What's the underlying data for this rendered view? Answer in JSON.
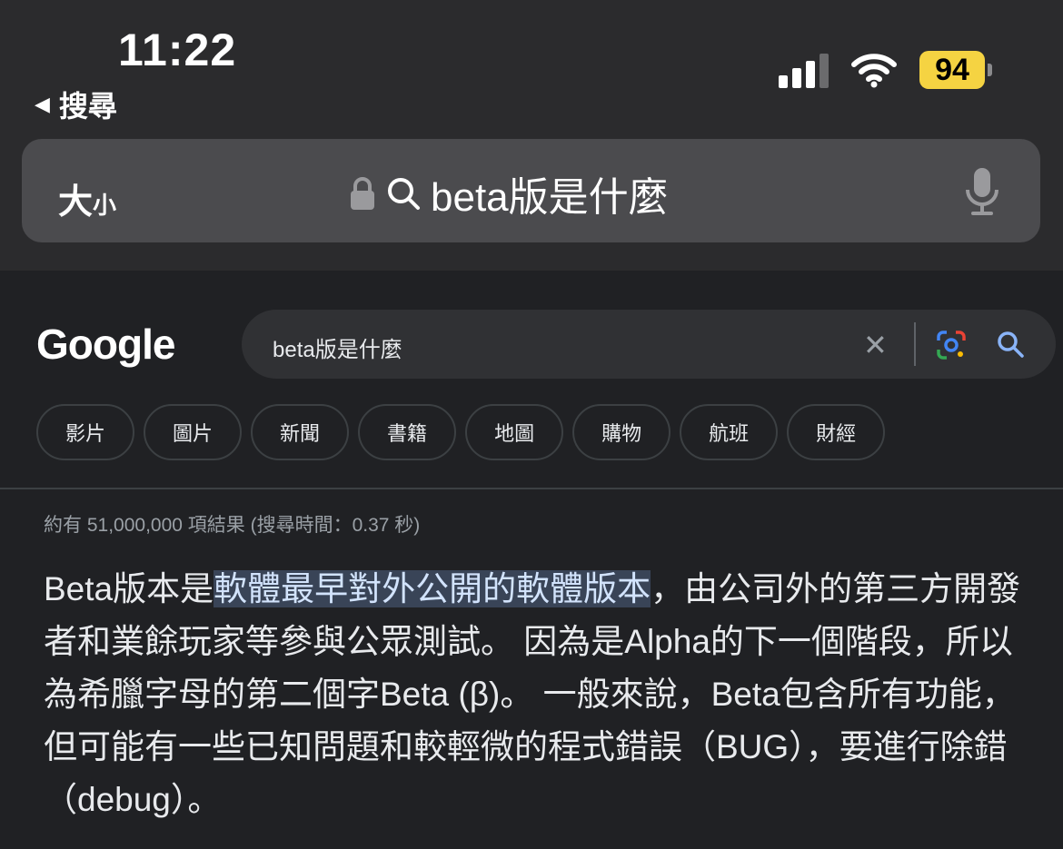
{
  "status_bar": {
    "time": "11:22",
    "back_label": "搜尋",
    "battery": "94"
  },
  "safari": {
    "text_size_big": "大",
    "text_size_small": "小",
    "url_query": "beta版是什麼"
  },
  "google": {
    "logo": "Google",
    "search_value": "beta版是什麼",
    "chips": [
      "影片",
      "圖片",
      "新聞",
      "書籍",
      "地圖",
      "購物",
      "航班",
      "財經"
    ],
    "result_stats": "約有 51,000,000 項結果 (搜尋時間：0.37 秒)",
    "answer": {
      "before": "Beta版本是",
      "highlight": "軟體最早對外公開的軟體版本",
      "after": "，由公司外的第三方開發者和業餘玩家等參與公眾測試。 因為是Alpha的下一個階段，所以為希臘字母的第二個字Beta (β)。 一般來說，Beta包含所有功能，但可能有一些已知問題和較輕微的程式錯誤（BUG），要進行除錯（debug）。"
    }
  },
  "colors": {
    "background": "#202124",
    "chrome": "#2b2b2d",
    "highlight_bg": "#394457",
    "battery": "#f5d342"
  }
}
